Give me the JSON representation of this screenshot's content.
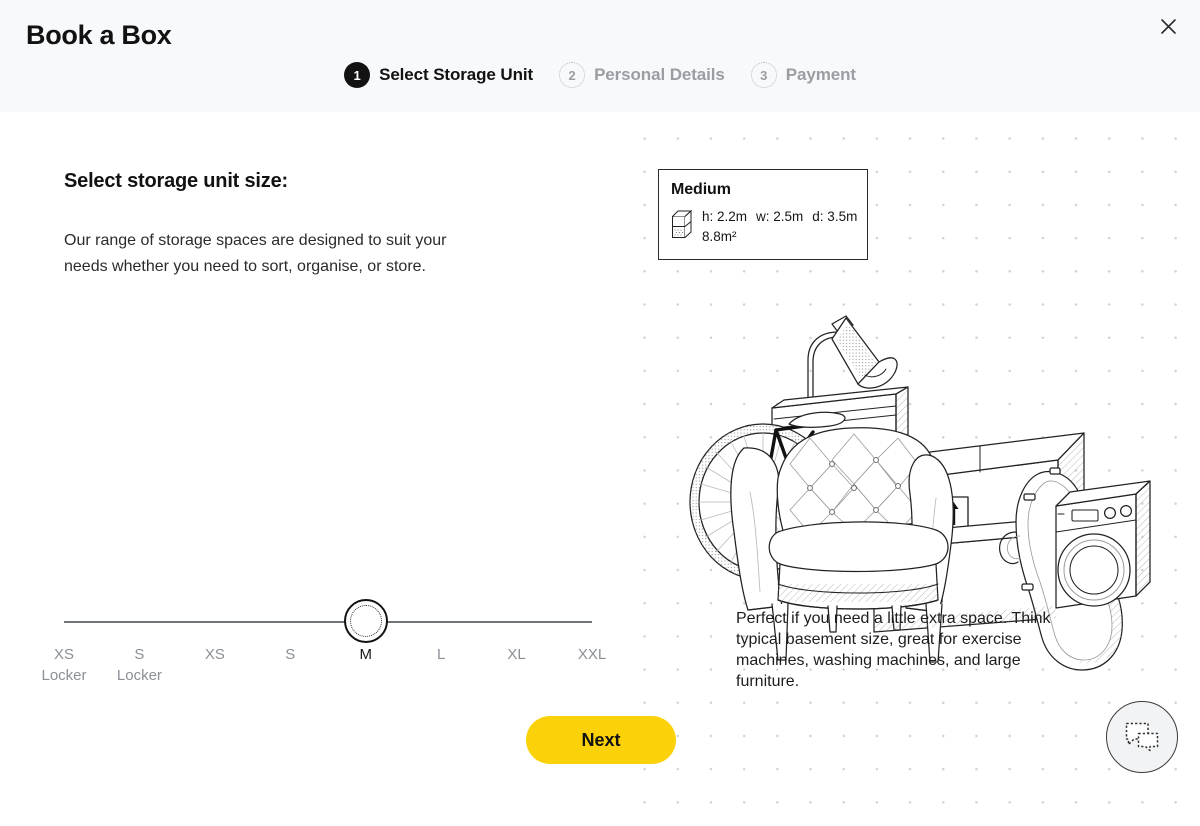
{
  "header": {
    "title": "Book a Box",
    "close_icon": "close-icon",
    "steps": [
      {
        "number": "1",
        "label": "Select Storage Unit",
        "state": "active"
      },
      {
        "number": "2",
        "label": "Personal Details",
        "state": "inactive"
      },
      {
        "number": "3",
        "label": "Payment",
        "state": "inactive"
      }
    ]
  },
  "left": {
    "heading": "Select storage unit size:",
    "body": "Our range of storage spaces are designed to suit your needs whether you need to sort, organise, or store.",
    "slider": {
      "selected_index": 4,
      "options": [
        {
          "size": "XS",
          "sub": "Locker"
        },
        {
          "size": "S",
          "sub": "Locker"
        },
        {
          "size": "XS",
          "sub": ""
        },
        {
          "size": "S",
          "sub": ""
        },
        {
          "size": "M",
          "sub": ""
        },
        {
          "size": "L",
          "sub": ""
        },
        {
          "size": "XL",
          "sub": ""
        },
        {
          "size": "XXL",
          "sub": ""
        }
      ]
    },
    "next_label": "Next"
  },
  "right": {
    "card": {
      "title": "Medium",
      "icon": "storage-unit-box-icon",
      "height": "h: 2.2m",
      "width": "w: 2.5m",
      "depth": "d: 3.5m",
      "area": "8.8m²"
    },
    "illustration_name": "storage-items-line-art",
    "description": "Perfect if you need a little extra space. Think typical basement size, great for exercise machines, washing machines, and large furniture.",
    "chat_icon": "chat-bubbles-icon"
  },
  "colors": {
    "accent_yellow": "#fbd209",
    "header_bg": "#f8f9fb",
    "text_dark": "#121212",
    "text_muted": "#9a9ea3",
    "dot_grid": "#d0d2d6"
  }
}
